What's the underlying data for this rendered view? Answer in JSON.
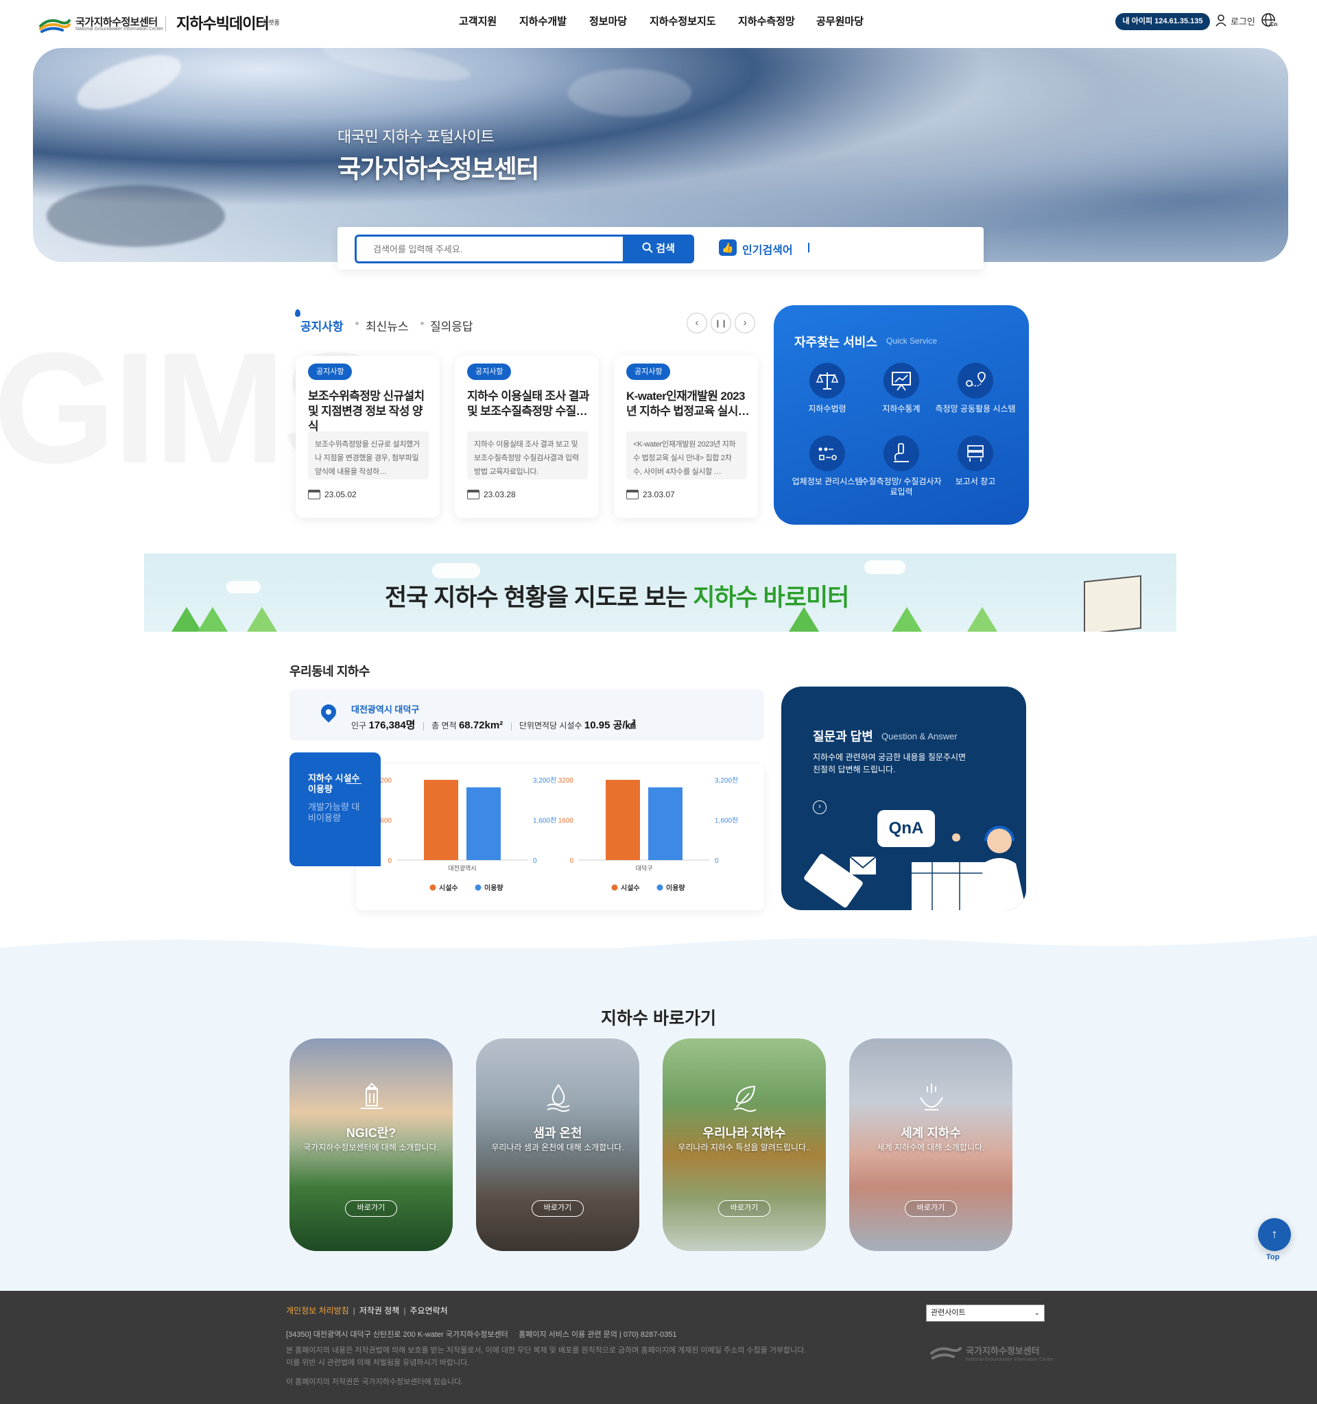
{
  "header": {
    "logo_text": "국가지하수정보센터",
    "logo_sub": "National Groundwater Information Center",
    "logo2_text": "지하수빅데이터",
    "logo2_tag": "플랫폼",
    "nav": [
      "고객지원",
      "지하수개발",
      "정보마당",
      "지하수정보지도",
      "지하수측정망",
      "공무원마당"
    ],
    "ip_label": "내 아이피 124.61.35.135",
    "login_label": "로그인",
    "lang_label": "En"
  },
  "hero": {
    "subtitle": "대국민 지하수 포털사이트",
    "title": "국가지하수정보센터",
    "search_placeholder": "검색어를 입력해 주세요.",
    "search_button": "검색",
    "popular_label": "인기검색어"
  },
  "notice": {
    "watermark": "GIMS",
    "tabs": [
      "공지사항",
      "최신뉴스",
      "질의응답"
    ],
    "cards": [
      {
        "badge": "공지사항",
        "title": "보조수위측정망 신규설치 및 지점변경 정보 작성 양식",
        "desc": "보조수위측정망을 신규로 설치했거나 지점을 변경했을 경우, 첨부파일 양식에 내용을 작성하…",
        "date": "23.05.02"
      },
      {
        "badge": "공지사항",
        "title": "지하수 이용실태 조사 결과 및 보조수질측정망 수질…",
        "desc": "지하수 이용실태 조사 결과 보고 및 보조수질측정망 수질검사결과 입력 방법 교육자료입니다.",
        "date": "23.03.28"
      },
      {
        "badge": "공지사항",
        "title": "K-water인재개발원 2023년 지하수 법정교육 실시…",
        "desc": "<K-water인재개발원 2023년 지하수 법정교육 실시 안내> 집합 2차수, 사이버 4차수를 실시할 …",
        "date": "23.03.07"
      }
    ]
  },
  "quick": {
    "title": "자주찾는 서비스",
    "subtitle": "Quick Service",
    "items": [
      {
        "label": "지하수법령",
        "icon": "scale-icon"
      },
      {
        "label": "지하수통계",
        "icon": "presentation-chart-icon"
      },
      {
        "label": "측정망 공동활용 시스템",
        "icon": "route-pin-icon"
      },
      {
        "label": "업체정보 관리시스템",
        "icon": "process-flow-icon"
      },
      {
        "label": "수질측정망/ 수질검사자료입력",
        "icon": "microscope-icon"
      },
      {
        "label": "보고서 창고",
        "icon": "archive-icon"
      }
    ]
  },
  "banner": {
    "text": "전국 지하수 현황을 지도로 보는",
    "highlight": "지하수 바로미터"
  },
  "neighborhood": {
    "title": "우리동네 지하수",
    "region": "대전광역시 대덕구",
    "pop_label": "인구",
    "pop_value": "176,384명",
    "area_label": "총 면적",
    "area_value": "68.72km²",
    "density_label": "단위면적당 시설수",
    "density_value": "10.95 공/㎢",
    "box_title": "지하수 시설수 이용량",
    "box_sub": "개발가능량 대비이용량"
  },
  "chart_data": [
    {
      "type": "bar",
      "categories": [
        "대전광역시"
      ],
      "series": [
        {
          "name": "시설수",
          "values": [
            3200
          ],
          "color": "#e8712e"
        },
        {
          "name": "이용량",
          "values": [
            2900
          ],
          "color": "#3d8ae6"
        }
      ],
      "left_ticks": [
        "3200",
        "1600",
        "0"
      ],
      "right_ticks": [
        "3,200천",
        "1,600천",
        "0"
      ],
      "ylim": [
        0,
        3200
      ]
    },
    {
      "type": "bar",
      "categories": [
        "대덕구"
      ],
      "series": [
        {
          "name": "시설수",
          "values": [
            3200
          ],
          "color": "#e8712e"
        },
        {
          "name": "이용량",
          "values": [
            2900
          ],
          "color": "#3d8ae6"
        }
      ],
      "left_ticks": [
        "3200",
        "1600",
        "0"
      ],
      "right_ticks": [
        "3,200천",
        "1,600천",
        "0"
      ],
      "ylim": [
        0,
        3200
      ]
    }
  ],
  "qna": {
    "title": "질문과 답변",
    "subtitle": "Question & Answer",
    "desc_line1": "지하수에 관련하여 궁금한 내용을 질문주시면",
    "desc_line2": "친절히 답변해 드립니다.",
    "bubble": "QnA"
  },
  "shortcuts": {
    "title": "지하수 바로가기",
    "items": [
      {
        "title": "NGIC란?",
        "desc": "국가지하수정보센터에 대해 소개합니다.",
        "button": "바로가기"
      },
      {
        "title": "샘과 온천",
        "desc": "우리나라 샘과 온천에 대해 소개합니다.",
        "button": "바로가기"
      },
      {
        "title": "우리나라 지하수",
        "desc": "우리나라 지하수 특성을 알려드립니다..",
        "button": "바로가기"
      },
      {
        "title": "세계 지하수",
        "desc": "세계 지하수에 대해 소개합니다.",
        "button": "바로가기"
      }
    ],
    "top_label": "Top"
  },
  "footer": {
    "links": [
      "개인정보 처리방침",
      "저작권 정책",
      "주요연락처"
    ],
    "address": "[34350] 대전광역시 대덕구 신탄진로 200 K-water 국가지하수정보센터",
    "contact": "홈페이지 서비스 이용 관련 문의 | 070) 8287-0351",
    "note1": "본 홈페이지의 내용은 저작권법에 의해 보호를 받는 저작물로서, 이에 대한 무단 복제 및 배포를 원칙적으로 금하며 홈페이지에 게재된 이메일 주소의 수집을 거부합니다.",
    "note2": "이를 위반 시 관련법에 의해 처벌됨을 유념하시기 바랍니다.",
    "copyright": "이 홈페이지의 저작권은 국가지하수정보센터에 있습니다.",
    "select_label": "관련사이트",
    "logo_text": "국가지하수정보센터",
    "logo_sub": "National Groundwater Information Center"
  }
}
